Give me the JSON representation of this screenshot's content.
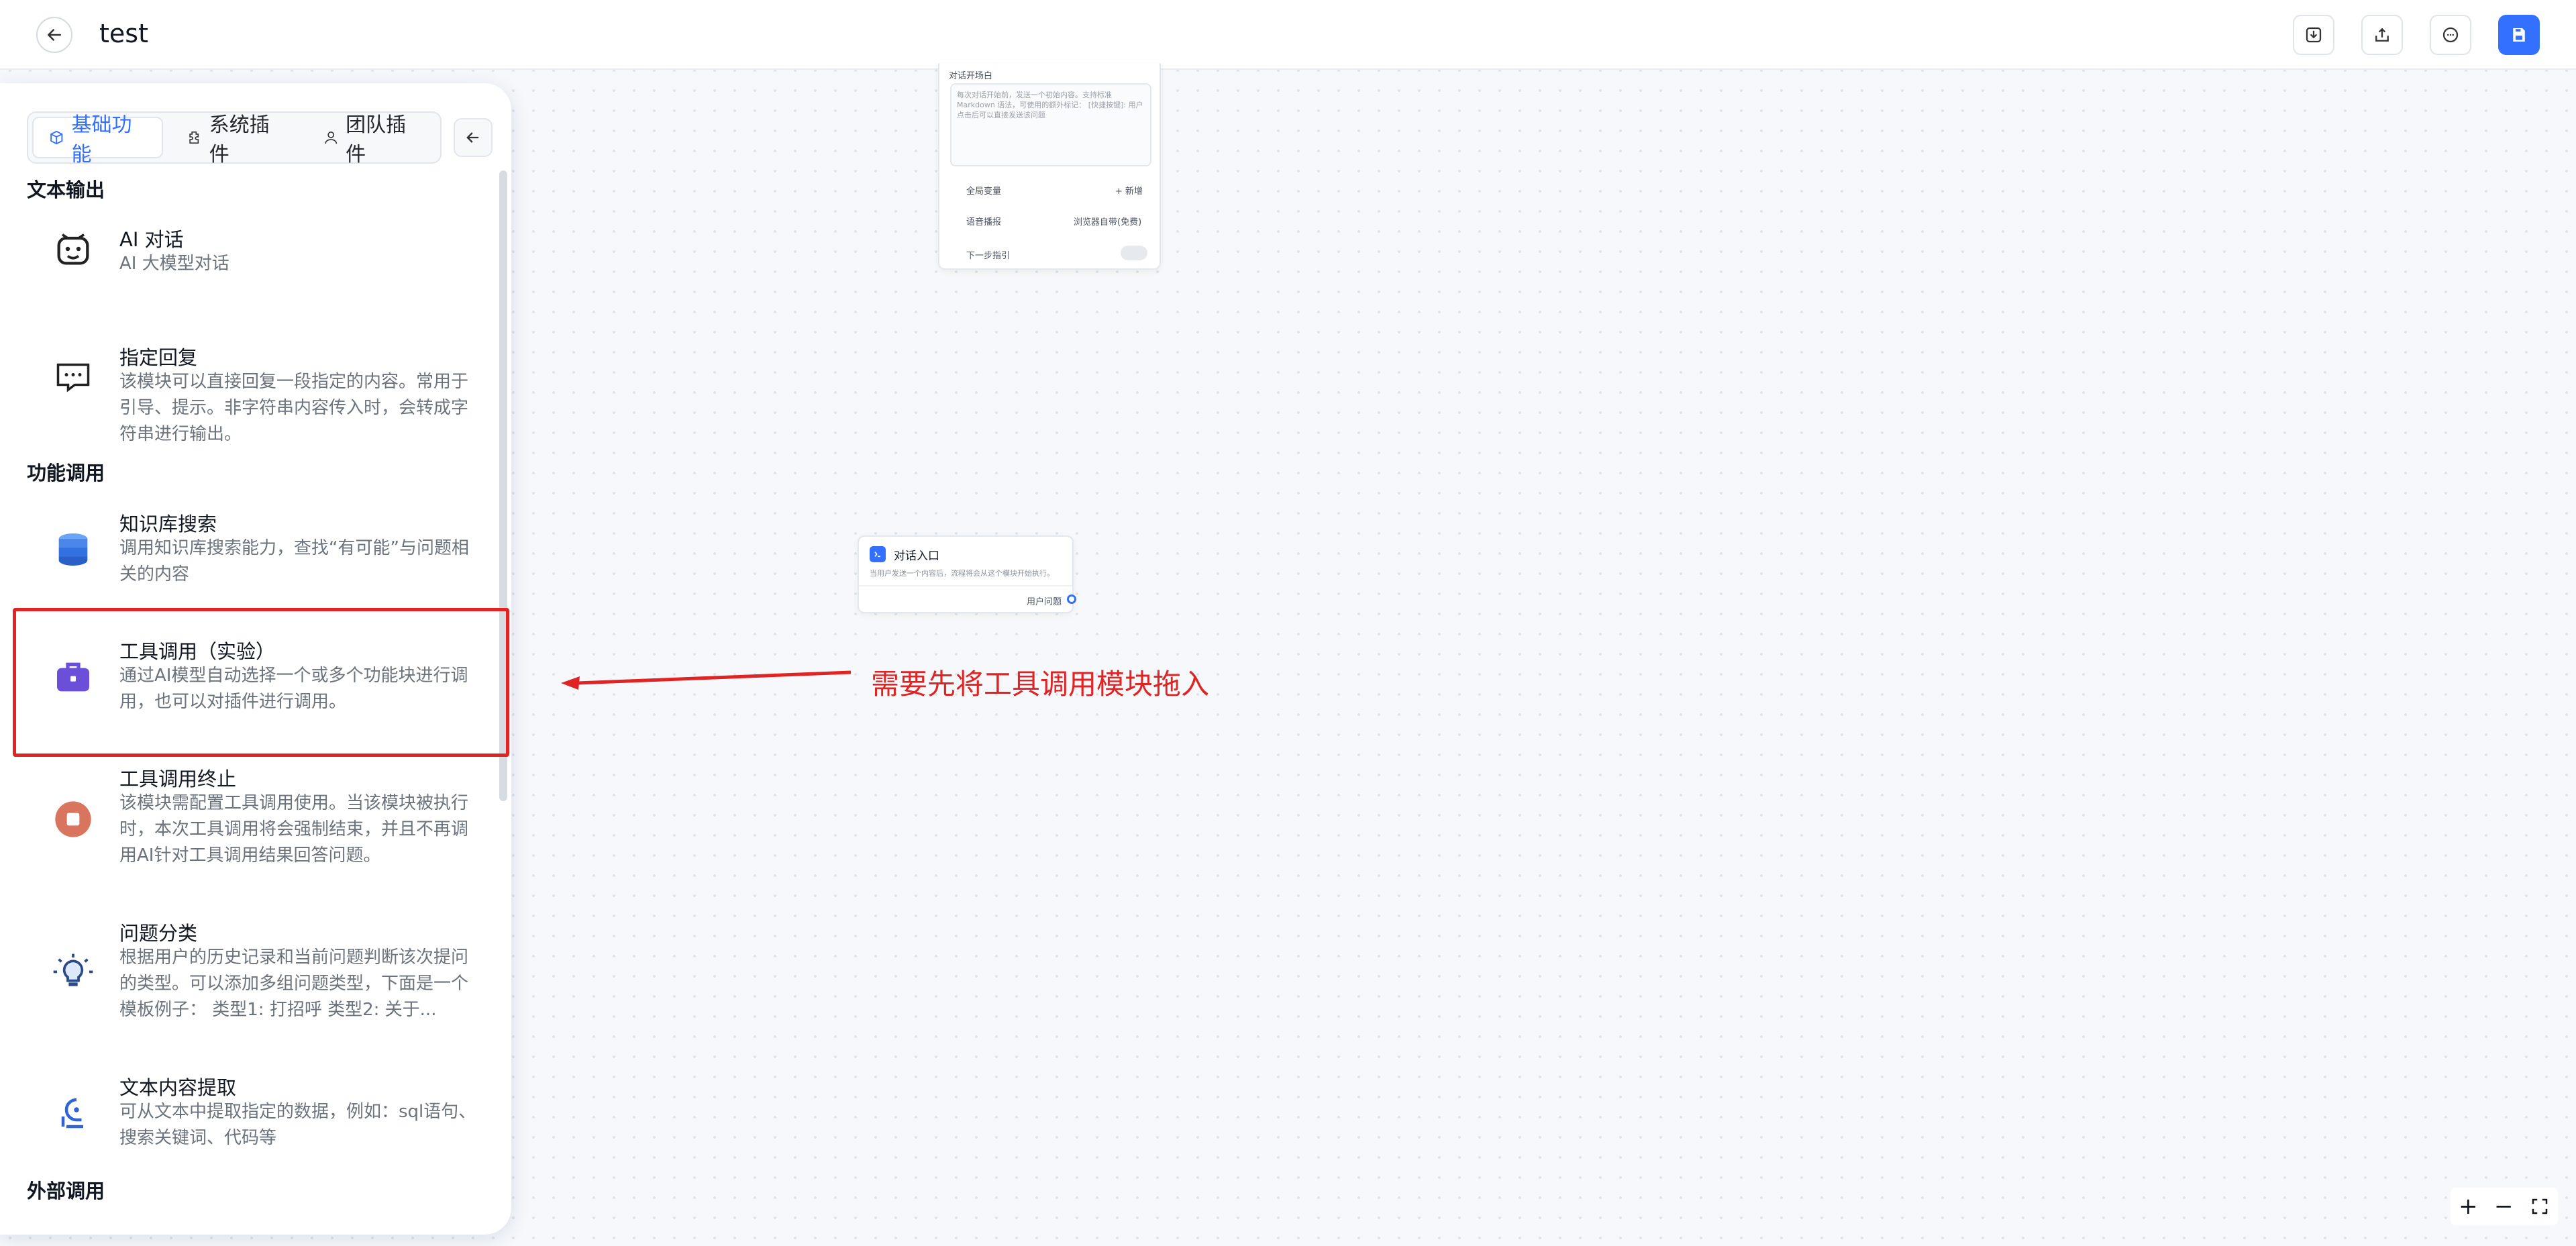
{
  "header": {
    "title": "test"
  },
  "tabs": [
    {
      "label": "基础功能"
    },
    {
      "label": "系统插件"
    },
    {
      "label": "团队插件"
    }
  ],
  "sections": {
    "text_output": "文本输出",
    "function_call": "功能调用",
    "external_call": "外部调用"
  },
  "items": [
    {
      "name": "AI 对话",
      "desc": "AI 大模型对话"
    },
    {
      "name": "指定回复",
      "desc": "该模块可以直接回复一段指定的内容。常用于引导、提示。非字符串内容传入时，会转成字符串进行输出。"
    },
    {
      "name": "知识库搜索",
      "desc": "调用知识库搜索能力，查找“有可能”与问题相关的内容"
    },
    {
      "name": "工具调用（实验）",
      "desc": "通过AI模型自动选择一个或多个功能块进行调用，也可以对插件进行调用。"
    },
    {
      "name": "工具调用终止",
      "desc": "该模块需配置工具调用使用。当该模块被执行时，本次工具调用将会强制结束，并且不再调用AI针对工具调用结果回答问题。"
    },
    {
      "name": "问题分类",
      "desc": "根据用户的历史记录和当前问题判断该次提问的类型。可以添加多组问题类型，下面是一个模板例子： 类型1: 打招呼 类型2: 关于..."
    },
    {
      "name": "文本内容提取",
      "desc": "可从文本中提取指定的数据，例如：sql语句、搜索关键词、代码等"
    }
  ],
  "canvas": {
    "start_node": {
      "opening_label": "对话开场白",
      "opening_placeholder": "每次对话开始前，发送一个初始内容。支持标准 Markdown 语法，可使用的额外标记： [快捷按键]: 用户点击后可以直接发送该问题",
      "global_vars_label": "全局变量",
      "add_label": "+ 新增",
      "tts_label": "语音播报",
      "tts_value": "浏览器自带(免费)",
      "next_guide_label": "下一步指引"
    },
    "entry_node": {
      "title": "对话入口",
      "desc": "当用户发送一个内容后，流程将会从这个模块开始执行。",
      "output_label": "用户问题"
    },
    "annotation": "需要先将工具调用模块拖入"
  },
  "icons": {
    "back": "arrow-left-icon",
    "import": "import-icon",
    "export": "export-icon",
    "chat": "chat-icon",
    "save": "save-icon"
  },
  "colors": {
    "primary": "#3370ff",
    "annotation_red": "#e02323"
  }
}
